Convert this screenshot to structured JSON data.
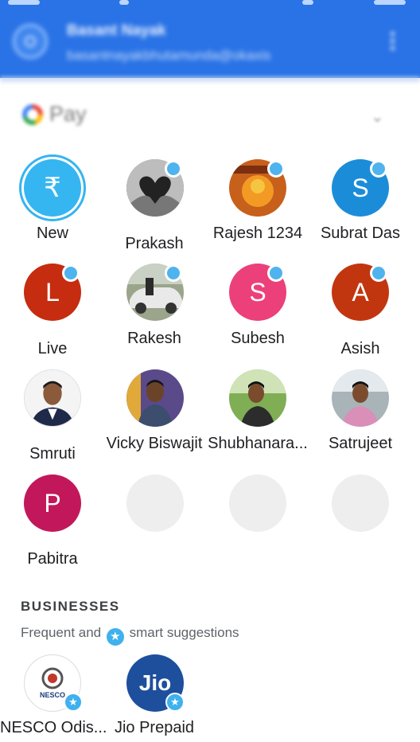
{
  "header": {
    "account_name": "Basant Nayak",
    "account_email": "basantnayakbhutamunda@okaxis"
  },
  "gpay": {
    "logo_text": "Pay",
    "chevron": "chevron-down-icon"
  },
  "contacts": [
    {
      "name": "New",
      "initial": "₹",
      "color": "#35b6f1"
    },
    {
      "name": "Prakash",
      "photo": true
    },
    {
      "name": "Rajesh 1234",
      "photo": true
    },
    {
      "name": "Subrat Das",
      "initial": "S",
      "color": "#1b8dd8"
    },
    {
      "name": "Live",
      "initial": "L",
      "color": "#c62c0f"
    },
    {
      "name": "Rakesh",
      "photo": true
    },
    {
      "name": "Subesh",
      "initial": "S",
      "color": "#ec407a"
    },
    {
      "name": "Asish",
      "initial": "A",
      "color": "#c2360f"
    },
    {
      "name": "Smruti",
      "photo": true
    },
    {
      "name": "Vicky Biswajit",
      "photo": true
    },
    {
      "name": "Shubhanara...",
      "photo": true
    },
    {
      "name": "Satrujeet",
      "photo": true
    },
    {
      "name": "Pabitra",
      "initial": "P",
      "color": "#c2185b"
    }
  ],
  "businesses": {
    "title": "BUSINESSES",
    "subtitle_before": "Frequent and",
    "subtitle_after": "smart suggestions",
    "items": [
      {
        "name": "NESCO Odis...",
        "logo_text": "NESCO"
      },
      {
        "name": "Jio Prepaid",
        "logo_text": "Jio"
      }
    ]
  },
  "colors": {
    "header": "#2a73e6",
    "accent": "#35b6f1"
  }
}
